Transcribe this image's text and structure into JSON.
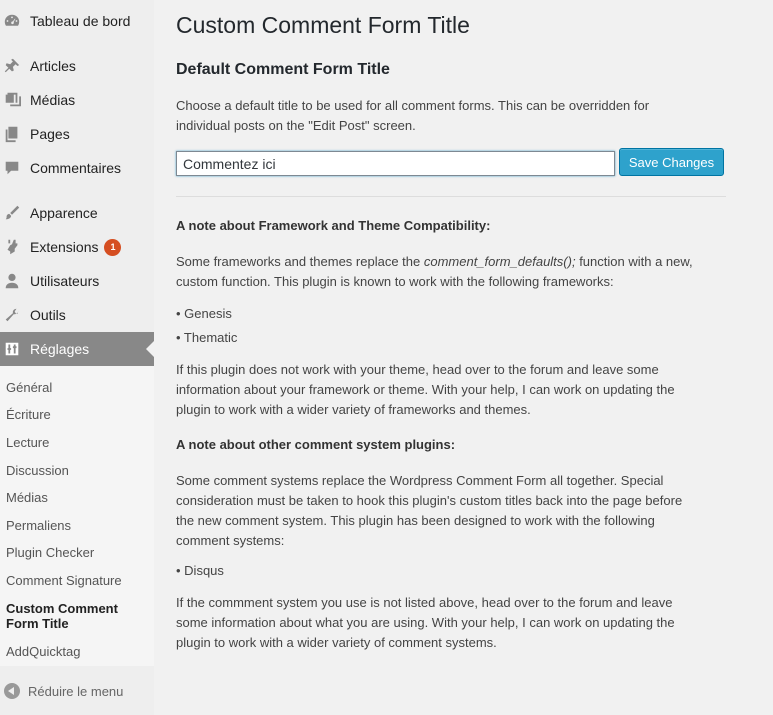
{
  "sidebar": {
    "items": [
      {
        "label": "Tableau de bord",
        "icon": "dashboard-icon"
      },
      {
        "label": "Articles",
        "icon": "pin-icon"
      },
      {
        "label": "Médias",
        "icon": "media-icon"
      },
      {
        "label": "Pages",
        "icon": "pages-icon"
      },
      {
        "label": "Commentaires",
        "icon": "comments-icon"
      },
      {
        "label": "Apparence",
        "icon": "brush-icon"
      },
      {
        "label": "Extensions",
        "icon": "plugin-icon",
        "badge": "1"
      },
      {
        "label": "Utilisateurs",
        "icon": "user-icon"
      },
      {
        "label": "Outils",
        "icon": "wrench-icon"
      },
      {
        "label": "Réglages",
        "icon": "settings-icon"
      }
    ],
    "submenu": [
      "Général",
      "Écriture",
      "Lecture",
      "Discussion",
      "Médias",
      "Permaliens",
      "Plugin Checker",
      "Comment Signature",
      "Custom Comment",
      "Form Title",
      "AddQuicktag"
    ],
    "collapse_label": "Réduire le menu"
  },
  "main": {
    "page_title": "Custom Comment Form Title",
    "section_title": "Default Comment Form Title",
    "intro_line1": "Choose a default title to be used for all comment forms. This can be overridden for",
    "intro_line2": "individual posts on the \"Edit Post\" screen.",
    "input_value": "Commentez ici",
    "save_label": "Save Changes",
    "note1_heading": "A note about Framework and Theme Compatibility:",
    "note1_p1_line1_a": "Some frameworks and themes replace the ",
    "note1_p1_line1_code": "comment_form_defaults();",
    "note1_p1_line1_b": " function with a new,",
    "note1_p1_line2": "custom function. This plugin is known to work with the following frameworks:",
    "frameworks": [
      "• Genesis",
      "• Thematic"
    ],
    "note1_p2_line1": "If this plugin does not work with your theme, head over to the forum and leave some",
    "note1_p2_line2": "information about your framework or theme. With your help, I can work on updating the",
    "note1_p2_line3": "plugin to work with a wider variety of frameworks and themes.",
    "note2_heading": "A note about other comment system plugins:",
    "note2_p1_line1": "Some comment systems replace the Wordpress Comment Form all together. Special",
    "note2_p1_line2": "consideration must be taken to hook this plugin's custom titles back into the page before",
    "note2_p1_line3": "the new comment system. This plugin has been designed to work with the following",
    "note2_p1_line4": "comment systems:",
    "systems": [
      "• Disqus"
    ],
    "note2_p2_line1": "If the commment system you use is not listed above, head over to the forum and leave",
    "note2_p2_line2": "some information about what you are using. With your help, I can work on updating the",
    "note2_p2_line3": "plugin to work with a wider variety of comment systems."
  },
  "colors": {
    "sidebar_bg": "#eeeeee",
    "active_menu_bg": "#888888",
    "badge": "#d54e21",
    "button": "#2ea2cc"
  }
}
